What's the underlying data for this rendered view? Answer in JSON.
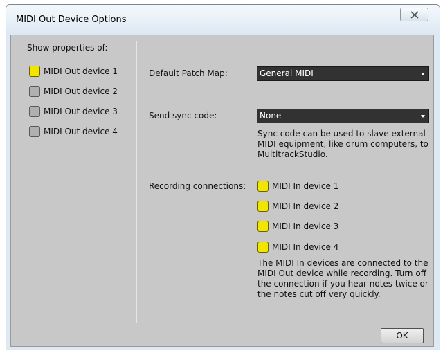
{
  "window": {
    "title": "MIDI Out Device Options",
    "close_glyph": "✕"
  },
  "left": {
    "heading": "Show properties of:",
    "devices": [
      {
        "label": "MIDI Out device 1",
        "checked": true
      },
      {
        "label": "MIDI Out device 2",
        "checked": false
      },
      {
        "label": "MIDI Out device 3",
        "checked": false
      },
      {
        "label": "MIDI Out device 4",
        "checked": false
      }
    ]
  },
  "patch_map": {
    "label": "Default Patch Map:",
    "value": "General MIDI"
  },
  "sync": {
    "label": "Send sync code:",
    "value": "None",
    "note_lines": [
      "Sync code can be used to slave external",
      "MIDI equipment, like drum computers, to",
      "MultitrackStudio."
    ]
  },
  "recording": {
    "label": "Recording connections:",
    "devices": [
      {
        "label": "MIDI In device 1",
        "checked": true
      },
      {
        "label": "MIDI In device 2",
        "checked": true
      },
      {
        "label": "MIDI In device 3",
        "checked": true
      },
      {
        "label": "MIDI In device 4",
        "checked": true
      }
    ],
    "note_lines": [
      "The MIDI In devices are connected to the",
      "MIDI Out device while recording. Turn off",
      "the connection if you hear notes twice or",
      "the notes cut off very quickly."
    ]
  },
  "buttons": {
    "ok": "OK"
  },
  "colors": {
    "checked": "#f2e600",
    "unchecked": "#b0b0b0",
    "dropdown_bg": "#323232",
    "panel_bg": "#c8c8c8"
  }
}
